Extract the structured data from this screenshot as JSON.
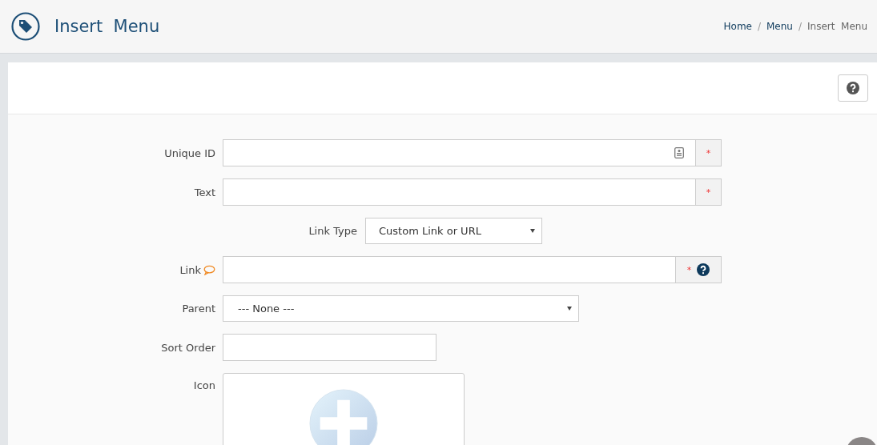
{
  "header": {
    "title": "Insert  Menu"
  },
  "breadcrumb": [
    {
      "label": "Home",
      "current": false
    },
    {
      "label": "Menu",
      "current": false
    },
    {
      "label": "Insert  Menu",
      "current": true
    }
  ],
  "breadcrumb_separator": "/",
  "form": [
    {
      "kind": "id-input",
      "label": "Unique ID",
      "addon": "*"
    },
    {
      "kind": "input",
      "label": "Text",
      "addon": "*"
    },
    {
      "kind": "inline-select",
      "label": "Link Type",
      "value": "Custom Link or URL"
    },
    {
      "kind": "link-input",
      "label": "Link",
      "addon": "*"
    },
    {
      "kind": "select",
      "label": "Parent",
      "value": "--- None ---"
    },
    {
      "kind": "short-input",
      "label": "Sort Order"
    },
    {
      "kind": "image",
      "label": "Icon"
    }
  ]
}
